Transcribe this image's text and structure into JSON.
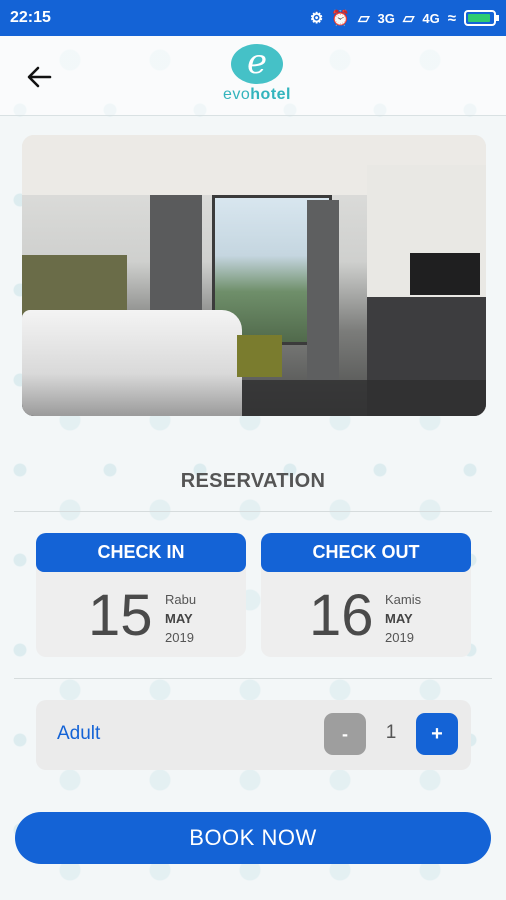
{
  "status_bar": {
    "time": "22:15",
    "network_1": "3G",
    "network_2": "4G"
  },
  "header": {
    "logo_letter": "e",
    "logo_text_prefix": "evo",
    "logo_text_suffix": "hotel",
    "icons": {
      "back": "arrow-left-icon"
    }
  },
  "reservation": {
    "title": "RESERVATION",
    "check_in": {
      "label": "CHECK IN",
      "day": "15",
      "weekday": "Rabu",
      "month": "MAY",
      "year": "2019"
    },
    "check_out": {
      "label": "CHECK OUT",
      "day": "16",
      "weekday": "Kamis",
      "month": "MAY",
      "year": "2019"
    },
    "guests": {
      "label": "Adult",
      "value": "1",
      "minus_label": "-",
      "plus_label": "+"
    }
  },
  "actions": {
    "book_label": "BOOK NOW"
  },
  "colors": {
    "primary": "#1463d6",
    "accent_teal": "#45c1c7",
    "disabled": "#9e9e9e"
  }
}
